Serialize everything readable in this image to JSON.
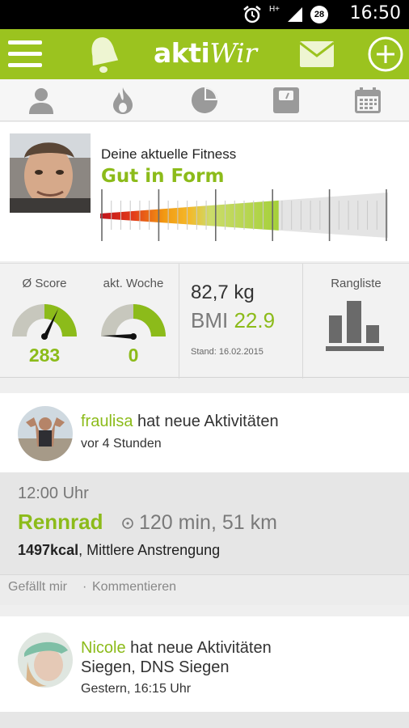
{
  "status_bar": {
    "time": "16:50",
    "notification_badge": "28",
    "network_label": "H+"
  },
  "app_bar": {
    "logo_prefix": "akti",
    "logo_suffix": "Wir"
  },
  "fitness": {
    "label": "Deine aktuelle Fitness",
    "status": "Gut in Form",
    "level_fraction": 0.62
  },
  "stats": {
    "score_label": "Ø Score",
    "score_value": "283",
    "week_label": "akt. Woche",
    "week_value": "0",
    "weight": "82,7 kg",
    "bmi_label": "BMI",
    "bmi_value": "22.9",
    "stand": "Stand: 16.02.2015",
    "ranking_label": "Rangliste"
  },
  "feed": [
    {
      "username": "fraulisa",
      "action": "hat neue Aktivitäten",
      "time_ago": "vor 4 Stunden",
      "activity": {
        "time": "12:00 Uhr",
        "sport": "Rennrad",
        "duration_distance": "120 min, 51 km",
        "kcal": "1497kcal",
        "intensity": ", Mittlere Anstrengung"
      },
      "like_label": "Gefällt mir",
      "separator": "·",
      "comment_label": "Kommentieren"
    },
    {
      "username": "Nicole",
      "action": "hat neue Aktivitäten",
      "location": "Siegen, DNS Siegen",
      "time_ago": "Gestern, 16:15 Uhr"
    }
  ],
  "colors": {
    "brand_green": "#9bc31f",
    "accent_green": "#8cbb1a"
  }
}
